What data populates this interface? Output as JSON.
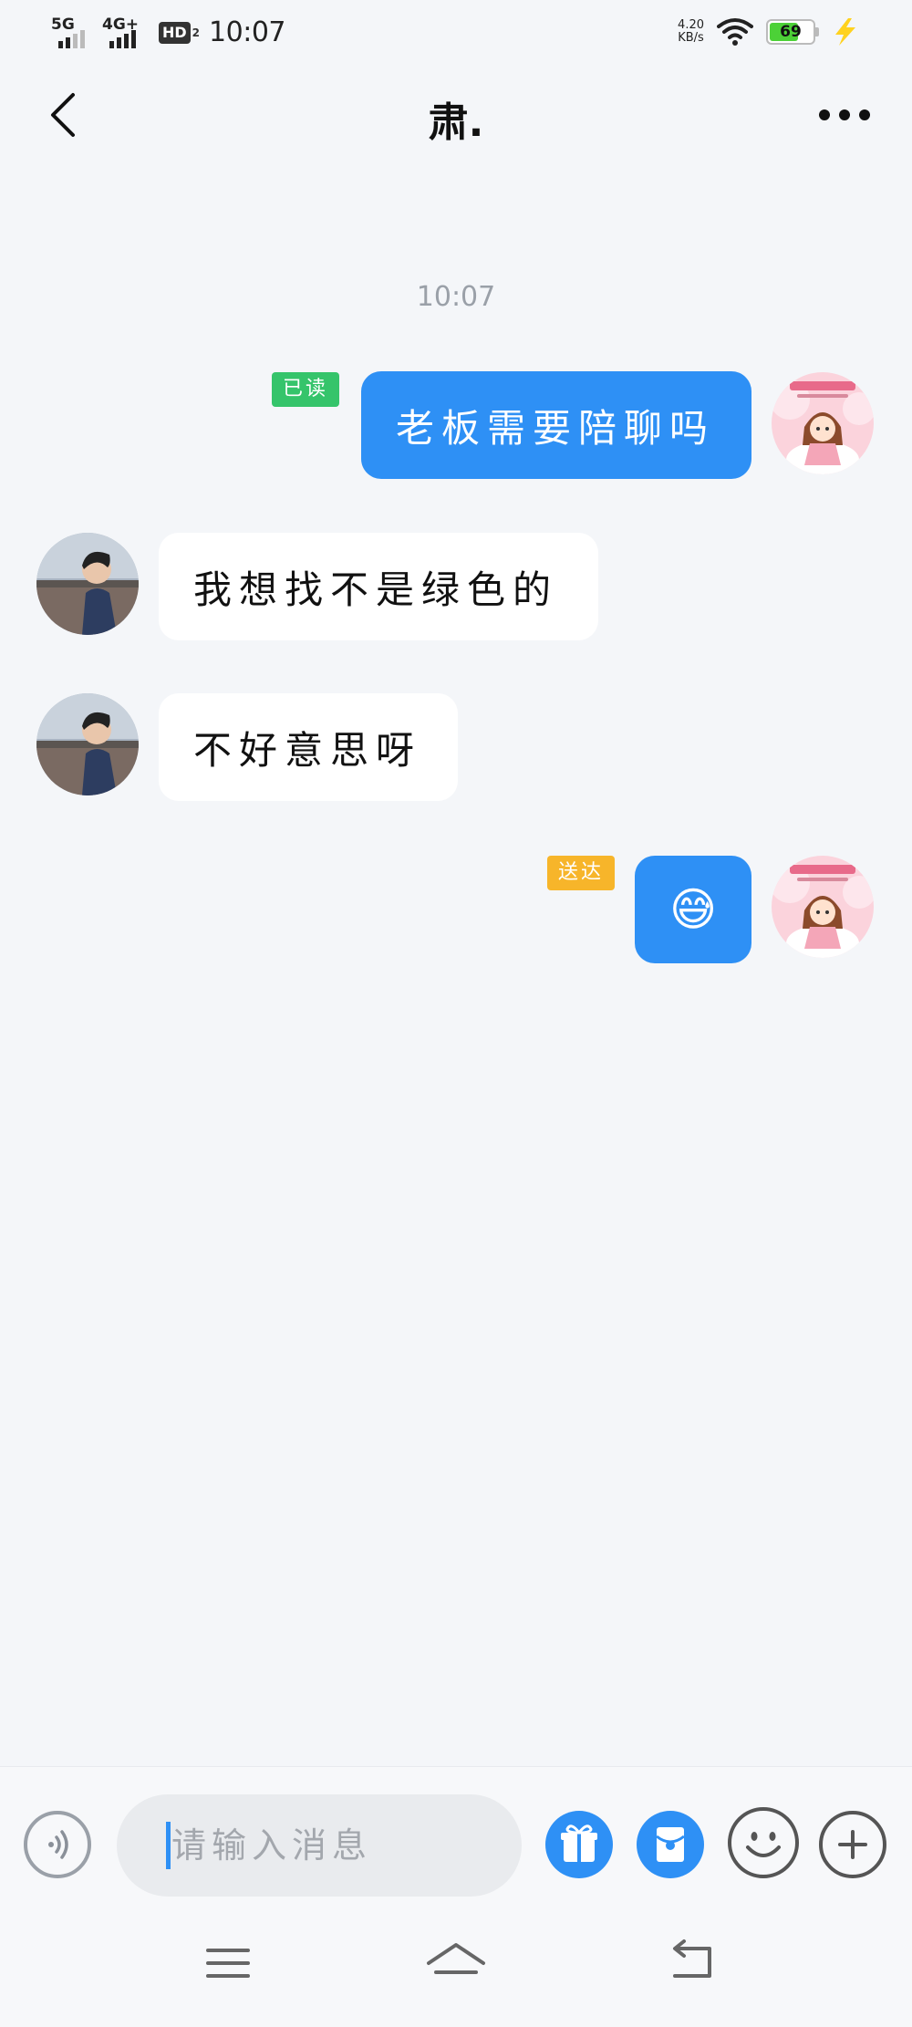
{
  "status_bar": {
    "network1": "5G",
    "network2": "4G+",
    "hd_label": "HD",
    "hd_sub": "2",
    "time": "10:07",
    "speed_value": "4.20",
    "speed_unit": "KB/s",
    "battery_level": "69",
    "battery_color": "#4cd137"
  },
  "header": {
    "title": "肃.",
    "back_icon": "chevron-left-icon",
    "more_icon": "more-horizontal-icon"
  },
  "chat": {
    "timestamp": "10:07",
    "messages": [
      {
        "direction": "outgoing",
        "text": "老板需要陪聊吗",
        "status": "已读",
        "status_color": "#35c46b"
      },
      {
        "direction": "incoming",
        "text": "我想找不是绿色的"
      },
      {
        "direction": "incoming",
        "text": "不好意思呀"
      },
      {
        "direction": "outgoing",
        "text": "😅",
        "status": "送达",
        "status_color": "#f7b52a"
      }
    ]
  },
  "input_bar": {
    "placeholder": "请输入消息",
    "icons": [
      "voice-icon",
      "gift-icon",
      "red-envelope-icon",
      "emoji-icon",
      "plus-icon"
    ],
    "accent_color": "#2e90f5"
  },
  "nav_bar": {
    "icons": [
      "menu-icon",
      "home-icon",
      "back-icon"
    ]
  }
}
